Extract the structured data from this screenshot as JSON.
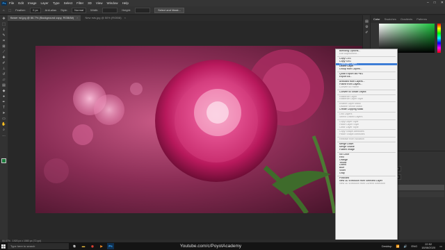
{
  "menu": {
    "app_logo": "Ps",
    "items": [
      "File",
      "Edit",
      "Image",
      "Layer",
      "Type",
      "Select",
      "Filter",
      "3D",
      "View",
      "Window",
      "Help"
    ]
  },
  "window_controls": {
    "minimize": "–",
    "maximize": "□",
    "close": "✕"
  },
  "options_bar": {
    "feather_label": "Feather:",
    "feather_value": "0 px",
    "anti_alias": "Anti-alias",
    "style_label": "Style:",
    "style_value": "Normal",
    "width_label": "Width:",
    "height_label": "Height:",
    "select_mask_button": "Select and Mask..."
  },
  "tabs": [
    {
      "label": "flower rst.jpg @ 66.7% (Background copy, RGB/8#)",
      "active": true
    },
    {
      "label": "New rsts.jpg @ 50% (RGB/8)",
      "active": false
    }
  ],
  "panels": {
    "top_tabs": [
      "Color",
      "Swatches",
      "Gradients",
      "Patterns"
    ],
    "opacity_label": "Opacity:",
    "opacity_value": "100%",
    "fill_label": "Fill:",
    "fill_value": "100%"
  },
  "context_menu": [
    {
      "label": "Blending Options...",
      "state": "normal"
    },
    {
      "label": "Edit Adjustment...",
      "state": "disabled"
    },
    {
      "sep": true
    },
    {
      "label": "Copy CSS",
      "state": "normal"
    },
    {
      "label": "Copy SVG",
      "state": "normal"
    },
    {
      "label": "Duplicate Layer...",
      "state": "highlight"
    },
    {
      "label": "Delete Layer",
      "state": "normal"
    },
    {
      "label": "Group from Layers...",
      "state": "normal"
    },
    {
      "sep": true
    },
    {
      "label": "Quick Export as PNG",
      "state": "normal"
    },
    {
      "label": "Export As...",
      "state": "normal"
    },
    {
      "sep": true
    },
    {
      "label": "Artboard from Layers...",
      "state": "normal"
    },
    {
      "label": "Frame from Layers...",
      "state": "normal"
    },
    {
      "label": "Convert to Frame",
      "state": "disabled"
    },
    {
      "sep": true
    },
    {
      "label": "Convert to Smart Object",
      "state": "normal"
    },
    {
      "sep": true
    },
    {
      "label": "Rasterize Layer",
      "state": "disabled"
    },
    {
      "label": "Rasterize Layer Style",
      "state": "disabled"
    },
    {
      "sep": true
    },
    {
      "label": "Enable Layer Mask",
      "state": "disabled"
    },
    {
      "label": "Disable Vector Mask",
      "state": "disabled"
    },
    {
      "label": "Create Clipping Mask",
      "state": "normal"
    },
    {
      "sep": true
    },
    {
      "label": "Link Layers",
      "state": "disabled"
    },
    {
      "label": "Select Linked Layers",
      "state": "disabled"
    },
    {
      "sep": true
    },
    {
      "label": "Copy Layer Style",
      "state": "disabled"
    },
    {
      "label": "Paste Layer Style",
      "state": "disabled"
    },
    {
      "label": "Clear Layer Style",
      "state": "disabled"
    },
    {
      "sep": true
    },
    {
      "label": "Copy Shape Attributes",
      "state": "disabled"
    },
    {
      "label": "Paste Shape Attributes",
      "state": "disabled"
    },
    {
      "sep": true
    },
    {
      "label": "Release from Isolation",
      "state": "disabled"
    },
    {
      "sep": true
    },
    {
      "label": "Merge Down",
      "state": "normal"
    },
    {
      "label": "Merge Visible",
      "state": "normal"
    },
    {
      "label": "Flatten Image",
      "state": "normal"
    },
    {
      "sep": true
    },
    {
      "label": "No Color",
      "state": "normal"
    },
    {
      "label": "Red",
      "state": "normal"
    },
    {
      "label": "Orange",
      "state": "normal"
    },
    {
      "label": "Yellow",
      "state": "normal"
    },
    {
      "label": "Green",
      "state": "normal"
    },
    {
      "label": "Blue",
      "state": "normal"
    },
    {
      "label": "Violet",
      "state": "normal"
    },
    {
      "label": "Gray",
      "state": "normal"
    },
    {
      "sep": true
    },
    {
      "label": "Postcard",
      "state": "normal"
    },
    {
      "label": "New 3D Extrusion from Selected Layer",
      "state": "normal"
    },
    {
      "label": "New 3D Extrusion from Current Selection",
      "state": "disabled"
    }
  ],
  "status": {
    "zoom": "66.67%",
    "doc": "1920 px x 1080 px (72 ppi)"
  },
  "taskbar": {
    "search_placeholder": "Type here to search",
    "watermark": "Youtube.com/c/PoyotAcademy",
    "desktop_label": "Desktop",
    "lang": "ENG",
    "time": "22:52",
    "date": "18/08/2020"
  },
  "colors": {
    "accent": "#31a8ff",
    "menu_highlight": "#3d7dd6"
  }
}
